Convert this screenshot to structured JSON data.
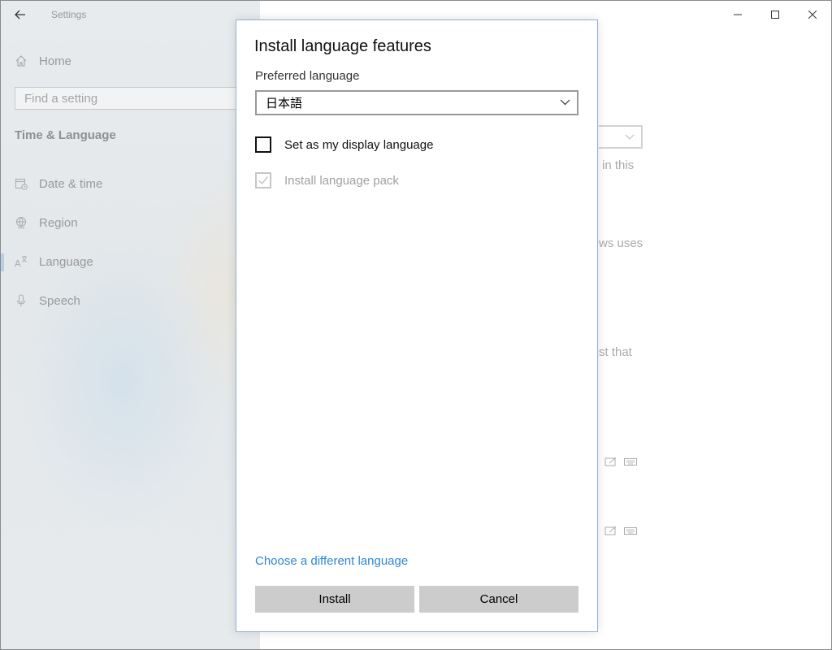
{
  "app": {
    "title": "Settings"
  },
  "window_controls": {
    "minimize_icon": "minimize-icon",
    "maximize_icon": "maximize-icon",
    "close_icon": "close-icon"
  },
  "sidebar": {
    "home_label": "Home",
    "search_placeholder": "Find a setting",
    "section_title": "Time & Language",
    "items": [
      {
        "label": "Date & time",
        "icon": "date-time-icon"
      },
      {
        "label": "Region",
        "icon": "globe-icon"
      },
      {
        "label": "Language",
        "icon": "language-icon",
        "active": true
      },
      {
        "label": "Speech",
        "icon": "microphone-icon"
      }
    ]
  },
  "background_content": {
    "fragment_1": "in this",
    "fragment_2": "ws uses",
    "fragment_3": "st that"
  },
  "dialog": {
    "title": "Install language features",
    "preferred_language_label": "Preferred language",
    "selected_language": "日本語",
    "display_language_label": "Set as my display language",
    "display_language_checked": false,
    "install_pack_label": "Install language pack",
    "install_pack_checked": true,
    "install_pack_disabled": true,
    "change_language_link": "Choose a different language",
    "install_button": "Install",
    "cancel_button": "Cancel"
  },
  "colors": {
    "link": "#2f86d1",
    "button_bg": "#cccccc",
    "accent_bar": "#b8cde6"
  }
}
